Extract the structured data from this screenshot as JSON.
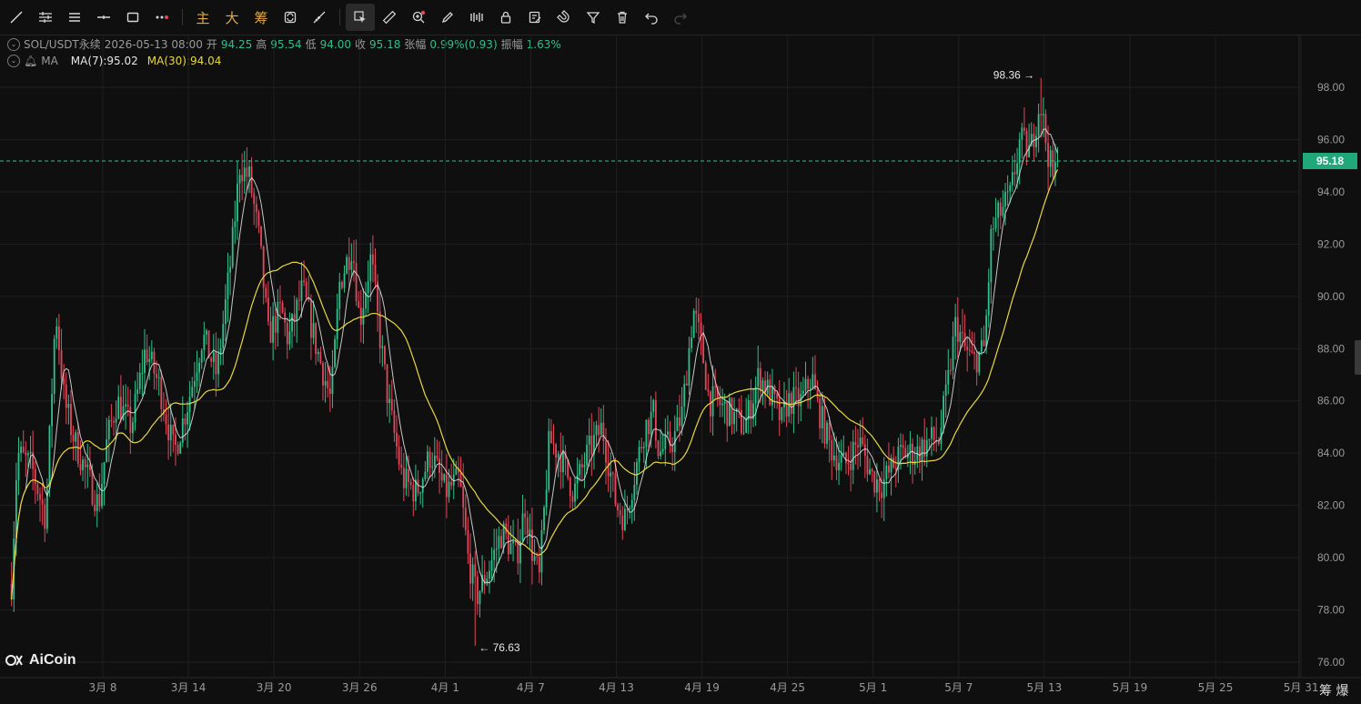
{
  "toolbar": {
    "tools": [
      "line-tool-icon",
      "multi-line-icon",
      "parallel-lines-icon",
      "horizontal-line-icon",
      "rectangle-icon",
      "more-tools-icon"
    ],
    "text_tools": [
      "主",
      "大",
      "筹"
    ],
    "actions": [
      "sync-icon",
      "measure-icon",
      "select-mode-icon",
      "ruler-icon",
      "zoom-add-icon",
      "brush-icon",
      "indicator-icon",
      "lock-icon",
      "edit-note-icon",
      "magnet-icon",
      "filter-icon",
      "delete-icon",
      "undo-icon",
      "redo-icon"
    ]
  },
  "info": {
    "symbol": "SOL/USDT永续",
    "datetime": "2026-05-13 08:00",
    "open_label": "开",
    "open": "94.25",
    "high_label": "高",
    "high": "95.54",
    "low_label": "低",
    "low": "94.00",
    "close_label": "收",
    "close": "95.18",
    "change_label": "张幅",
    "change": "0.99%(0.93)",
    "amp_label": "振幅",
    "amp": "1.63%",
    "ma_label": "MA",
    "ma7": "MA(7):95.02",
    "ma30": "MA(30):94.04"
  },
  "last_price": "95.18",
  "logo_text": "AiCoin",
  "corner_text": "筹 爆",
  "colors": {
    "up": "#2fbf8b",
    "down": "#e0475a",
    "ma7": "#e6e6e6",
    "ma30": "#e8d840",
    "grid": "#1f1f22",
    "bg": "#0f0f10"
  },
  "chart_data": {
    "type": "candlestick",
    "y_range": [
      75.6,
      99.8
    ],
    "y_ticks": [
      "98.00",
      "96.00",
      "94.00",
      "92.00",
      "90.00",
      "88.00",
      "86.00",
      "84.00",
      "82.00",
      "80.00",
      "78.00",
      "76.00"
    ],
    "x_ticks": [
      "3月 8",
      "3月 14",
      "3月 20",
      "3月 26",
      "4月 1",
      "4月 7",
      "4月 13",
      "4月 19",
      "4月 25",
      "5月 1",
      "5月 7",
      "5月 13",
      "5月 19",
      "5月 25",
      "5月 31"
    ],
    "x_tick_days": [
      0,
      6,
      12,
      18,
      24,
      30,
      36,
      42,
      48,
      54,
      60,
      66,
      72,
      78,
      84
    ],
    "first_day": -6.4,
    "bars_per_day": 6,
    "current_price": 95.18,
    "max_label": "98.36",
    "min_label": "76.63",
    "max": {
      "day": 65.7,
      "value": 98.36
    },
    "min": {
      "day": 26.1,
      "value": 76.63
    },
    "close_anchors": [
      [
        -6.4,
        79.0
      ],
      [
        -6,
        84
      ],
      [
        -5,
        83.5
      ],
      [
        -4,
        81.5
      ],
      [
        -3.3,
        89.5
      ],
      [
        -2.7,
        86
      ],
      [
        -2,
        84.5
      ],
      [
        -1,
        83
      ],
      [
        -0.3,
        82
      ],
      [
        0.3,
        84.5
      ],
      [
        1,
        86
      ],
      [
        2,
        85
      ],
      [
        3,
        88
      ],
      [
        4,
        86.5
      ],
      [
        5,
        84
      ],
      [
        6,
        86
      ],
      [
        7,
        88.5
      ],
      [
        8,
        87
      ],
      [
        9,
        91.5
      ],
      [
        9.6,
        95
      ],
      [
        10.3,
        94.5
      ],
      [
        11,
        92
      ],
      [
        11.6,
        88.5
      ],
      [
        12.5,
        89.5
      ],
      [
        13,
        88.3
      ],
      [
        14,
        90.3
      ],
      [
        15,
        88
      ],
      [
        16,
        86
      ],
      [
        16.6,
        90.5
      ],
      [
        17.5,
        92
      ],
      [
        18,
        89
      ],
      [
        18.8,
        91.5
      ],
      [
        19.3,
        89
      ],
      [
        20,
        86
      ],
      [
        21,
        83
      ],
      [
        22,
        82.5
      ],
      [
        23,
        84
      ],
      [
        24,
        82.5
      ],
      [
        25,
        83
      ],
      [
        25.6,
        80
      ],
      [
        26.2,
        78.5
      ],
      [
        27,
        79.5
      ],
      [
        28,
        81
      ],
      [
        29,
        80
      ],
      [
        29.6,
        82
      ],
      [
        30,
        80.5
      ],
      [
        30.6,
        79.2
      ],
      [
        31.3,
        84.5
      ],
      [
        32,
        84
      ],
      [
        33,
        82.5
      ],
      [
        34,
        84
      ],
      [
        35,
        85
      ],
      [
        36,
        82
      ],
      [
        36.6,
        81.5
      ],
      [
        37,
        82.5
      ],
      [
        38,
        85
      ],
      [
        38.6,
        85.5
      ],
      [
        39,
        84
      ],
      [
        40,
        84.5
      ],
      [
        40.6,
        85.5
      ],
      [
        41.4,
        89.5
      ],
      [
        42,
        88
      ],
      [
        42.5,
        86
      ],
      [
        43,
        86
      ],
      [
        44,
        85.5
      ],
      [
        45,
        85
      ],
      [
        46,
        87
      ],
      [
        47,
        86
      ],
      [
        47.6,
        85.2
      ],
      [
        48,
        86
      ],
      [
        49,
        86
      ],
      [
        49.7,
        87
      ],
      [
        50,
        86
      ],
      [
        51,
        84.2
      ],
      [
        52,
        83.5
      ],
      [
        53,
        84.5
      ],
      [
        54,
        83
      ],
      [
        54.6,
        82.8
      ],
      [
        55.5,
        83.6
      ],
      [
        56,
        84
      ],
      [
        57,
        84
      ],
      [
        58,
        84.5
      ],
      [
        58.6,
        84.5
      ],
      [
        59.2,
        86.5
      ],
      [
        59.8,
        89
      ],
      [
        60.4,
        88
      ],
      [
        61,
        87.5
      ],
      [
        61.8,
        88
      ],
      [
        62.3,
        92.5
      ],
      [
        63,
        93.3
      ],
      [
        63.6,
        93.8
      ],
      [
        64.3,
        96
      ],
      [
        65,
        95.5
      ],
      [
        65.7,
        97.5
      ],
      [
        66.1,
        96
      ],
      [
        66.6,
        94.5
      ],
      [
        67.0,
        95.18
      ]
    ]
  }
}
